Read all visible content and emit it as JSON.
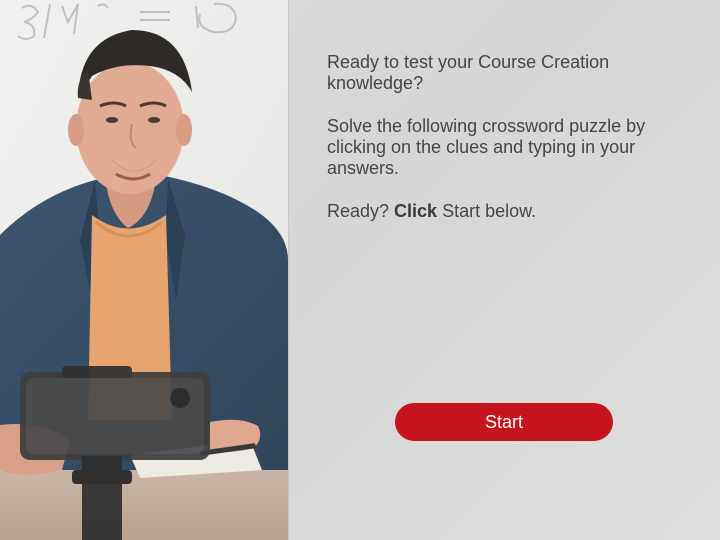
{
  "photo": {
    "alt_icon": "presenter-photo",
    "board_scribble": "3)14 = 10"
  },
  "intro": {
    "line1": "Ready to test your Course Creation knowledge?",
    "line2": "Solve the following crossword puzzle by clicking on the clues and typing in your answers.",
    "line3_prefix": "Ready? ",
    "line3_bold": "Click",
    "line3_suffix": " Start below."
  },
  "start_button": {
    "label": "Start"
  },
  "colors": {
    "accent": "#c5141d",
    "text": "#454545",
    "background": "#d9d9d9"
  }
}
